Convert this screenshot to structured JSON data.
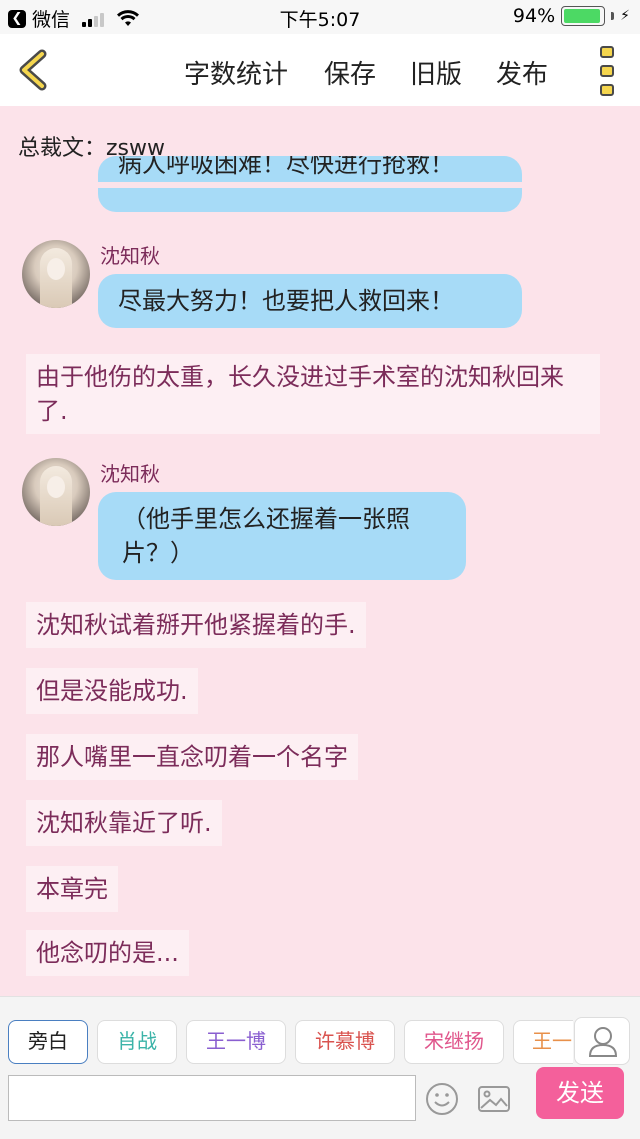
{
  "status_bar": {
    "back_app_label": "微信",
    "time": "下午5:07",
    "battery_text": "94%",
    "battery_level": 0.94
  },
  "nav": {
    "word_count": "字数统计",
    "save": "保存",
    "old_version": "旧版",
    "publish": "发布"
  },
  "document": {
    "title": "总裁文：zsww"
  },
  "messages": {
    "partial_bubble": "病人呼吸困难！尽快进行抢救！",
    "msg1_speaker": "沈知秋",
    "msg1_text": "尽最大努力！也要把人救回来！",
    "narration1": "由于他伤的太重，长久没进过手术室的沈知秋回来了.",
    "msg2_speaker": "沈知秋",
    "msg2_text": "（他手里怎么还握着一张照片？）",
    "narration2": "沈知秋试着掰开他紧握着的手.",
    "narration3": "但是没能成功.",
    "narration4": "那人嘴里一直念叨着一个名字",
    "narration5": "沈知秋靠近了听.",
    "narration6": "本章完",
    "narration7": "他念叨的是..."
  },
  "characters": [
    {
      "label": "旁白",
      "color": "#222222"
    },
    {
      "label": "肖战",
      "color": "#3bb3a8"
    },
    {
      "label": "王一博",
      "color": "#8a5fd0"
    },
    {
      "label": "许慕博",
      "color": "#d9534f"
    },
    {
      "label": "宋继扬",
      "color": "#e0568c"
    },
    {
      "label": "王一",
      "color": "#e8904a"
    }
  ],
  "composer": {
    "input_value": "",
    "send": "发送"
  },
  "colors": {
    "background": "#fce3ea",
    "bubble": "#a7dbf7",
    "narration_text": "#7c2c5a",
    "send_button": "#f4609b"
  }
}
